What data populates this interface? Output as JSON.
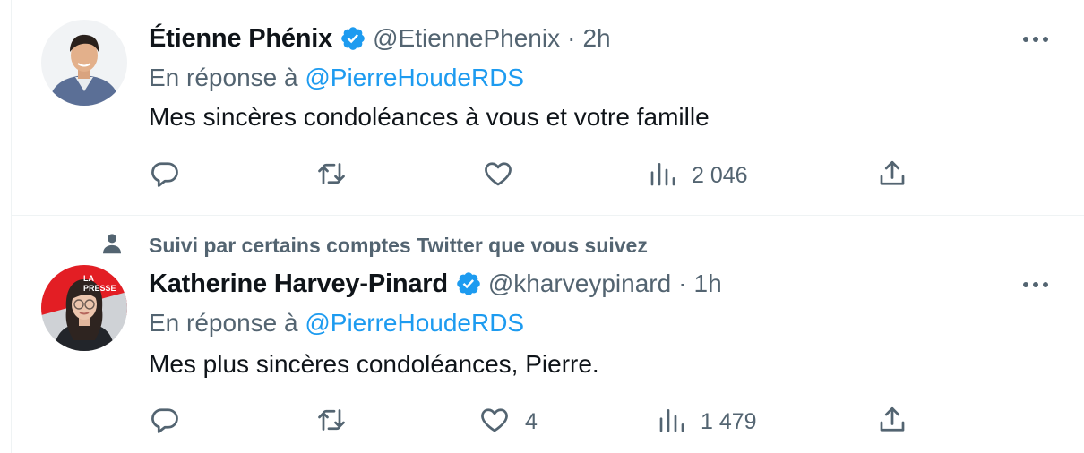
{
  "tweets": [
    {
      "author_name": "Étienne Phénix",
      "handle": "@EtiennePhenix",
      "separator": "·",
      "time": "2h",
      "reply_prefix": "En réponse à",
      "reply_mention": "@PierreHoudeRDS",
      "text": "Mes sincères condoléances à vous et votre famille",
      "likes": "",
      "views": "2 046",
      "verified": true
    },
    {
      "social_context": "Suivi par certains comptes Twitter que vous suivez",
      "author_name": "Katherine Harvey-Pinard",
      "handle": "@kharveypinard",
      "separator": "·",
      "time": "1h",
      "reply_prefix": "En réponse à",
      "reply_mention": "@PierreHoudeRDS",
      "text": "Mes plus sincères condoléances, Pierre.",
      "likes": "4",
      "views": "1 479",
      "verified": true,
      "avatar_logo_text": "LA PRESSE"
    }
  ],
  "colors": {
    "accent": "#1d9bf0",
    "secondary_text": "#536471",
    "primary_text": "#0f1419",
    "divider": "#eff3f4",
    "la_presse_red": "#e31e24"
  },
  "icons": [
    "more-icon",
    "reply-icon",
    "retweet-icon",
    "like-icon",
    "views-icon",
    "share-icon",
    "verified-icon",
    "person-icon"
  ]
}
